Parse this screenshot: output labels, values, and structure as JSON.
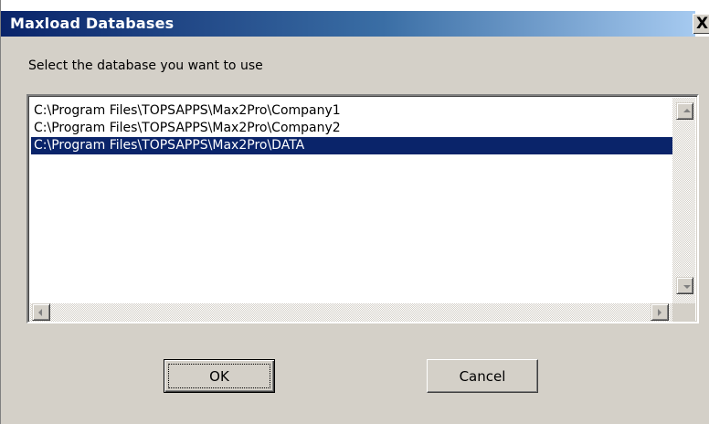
{
  "window": {
    "title": "Maxload Databases",
    "close_glyph": "X"
  },
  "prompt": "Select the database you want to use",
  "databases": {
    "items": [
      "C:\\Program Files\\TOPSAPPS\\Max2Pro\\Company1",
      "C:\\Program Files\\TOPSAPPS\\Max2Pro\\Company2",
      "C:\\Program Files\\TOPSAPPS\\Max2Pro\\DATA"
    ],
    "selected_index": 2
  },
  "buttons": {
    "ok_label": "OK",
    "cancel_label": "Cancel"
  },
  "colors": {
    "selection": "#0a246a",
    "titlebar_start": "#0a246a",
    "titlebar_end": "#a6caf0",
    "face": "#d4d0c8"
  },
  "icons": {
    "close": "close-icon",
    "scroll_up": "scroll-up-arrow-icon",
    "scroll_down": "scroll-down-arrow-icon",
    "scroll_left": "scroll-left-arrow-icon",
    "scroll_right": "scroll-right-arrow-icon"
  }
}
